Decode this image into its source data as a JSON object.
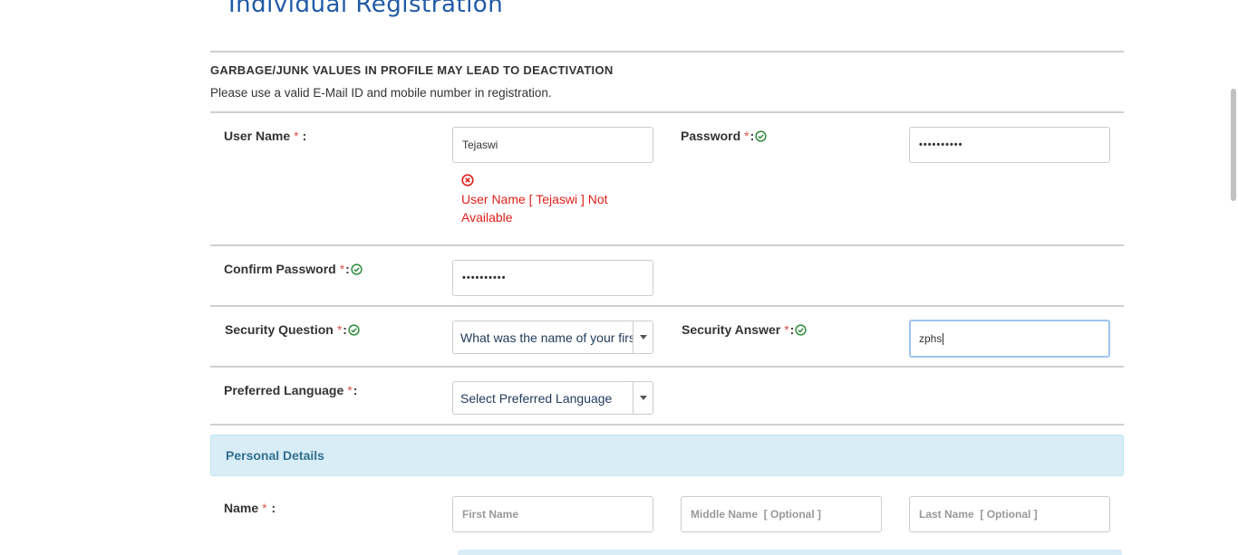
{
  "page": {
    "title": "Individual Registration"
  },
  "notice": {
    "title": "GARBAGE/JUNK VALUES IN PROFILE MAY LEAD TO DEACTIVATION",
    "subtitle": "Please use a valid E-Mail ID and mobile number in registration."
  },
  "form": {
    "required_mark": "*",
    "username": {
      "label": "User Name",
      "suffix": ":",
      "value": "Tejaswi",
      "error": "User Name [ Tejaswi ] Not Available"
    },
    "password": {
      "label": "Password",
      "suffix": ":",
      "value": "••••••••••"
    },
    "confirm_password": {
      "label": "Confirm Password",
      "suffix": ":",
      "value": "••••••••••"
    },
    "security_question": {
      "label": "Security Question",
      "suffix": ":",
      "selected": "What was the name of your first school?"
    },
    "security_answer": {
      "label": "Security Answer",
      "suffix": ":",
      "value": "zphs"
    },
    "preferred_language": {
      "label": "Preferred Language",
      "suffix": ":",
      "selected": "Select Preferred Language"
    }
  },
  "personal_details": {
    "heading": "Personal Details",
    "name": {
      "label": "Name",
      "suffix": " :",
      "first_placeholder": "First Name",
      "middle_placeholder": "Middle Name  [ Optional ]",
      "last_placeholder": "Last Name  [ Optional ]"
    }
  },
  "colors": {
    "title_blue": "#1f5aa6",
    "required_red": "#d9534f",
    "error_red": "#e0201b",
    "valid_green": "#2e8b3a",
    "panel_bg": "#d9edf7",
    "panel_text": "#31708f",
    "focus_border": "#9ec4ef"
  },
  "icons": {
    "valid": "check-circle-icon",
    "error": "x-circle-icon",
    "dropdown": "caret-down-icon"
  }
}
